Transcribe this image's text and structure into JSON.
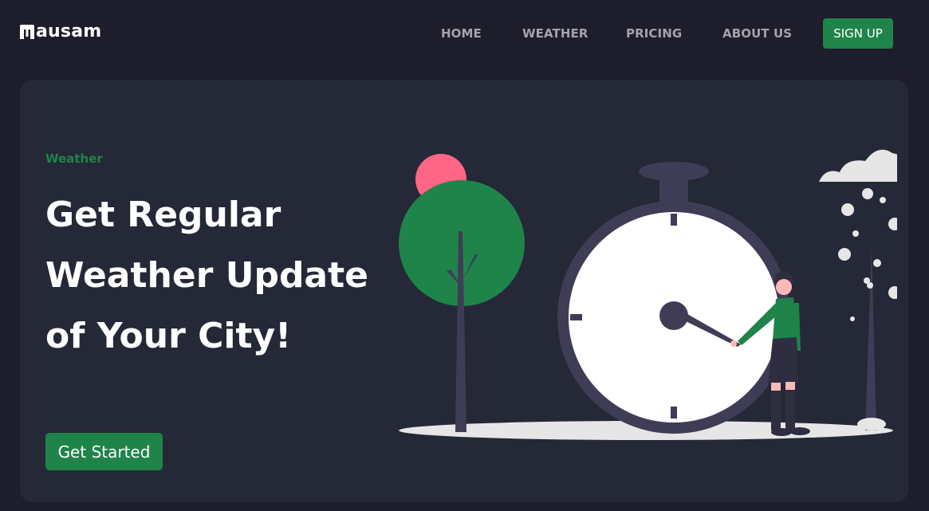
{
  "brand": {
    "name": "ausam"
  },
  "nav": {
    "items": [
      {
        "label": "HOME"
      },
      {
        "label": "WEATHER"
      },
      {
        "label": "PRICING"
      },
      {
        "label": "ABOUT US"
      }
    ],
    "signup_label": "SIGN UP"
  },
  "hero": {
    "tag": "Weather",
    "title": "Get Regular Weather Update of Your City!",
    "cta_label": "Get Started"
  },
  "colors": {
    "page_bg": "#1e1d2b",
    "card_bg": "#252837",
    "accent": "#1f8449",
    "nav_text": "#a3a3ac"
  },
  "illustration": {
    "icons": [
      "tree-icon",
      "sun-icon",
      "stopwatch-icon",
      "woman-figure-icon",
      "cloud-icon",
      "snow-icon"
    ]
  }
}
